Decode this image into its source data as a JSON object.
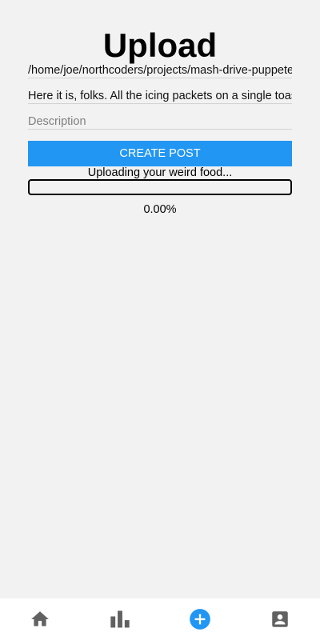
{
  "page": {
    "title": "Upload"
  },
  "form": {
    "file_path": "/home/joe/northcoders/projects/mash-drive-puppeteer",
    "caption": "Here it is, folks. All the icing packets on a single toaster",
    "description_placeholder": "Description",
    "create_label": "CREATE POST"
  },
  "upload": {
    "status_text": "Uploading your weird food...",
    "progress_fraction": 0.0,
    "percent_text": "0.00%"
  },
  "tabbar": {
    "tabs": [
      {
        "name": "home",
        "icon": "home-icon",
        "active": false
      },
      {
        "name": "leaderboard",
        "icon": "bar-chart-icon",
        "active": false
      },
      {
        "name": "upload",
        "icon": "add-circle-icon",
        "active": true
      },
      {
        "name": "profile",
        "icon": "account-box-icon",
        "active": false
      }
    ],
    "inactive_color": "#616161",
    "active_color": "#2196f3"
  },
  "colors": {
    "background": "#f2f2f2",
    "accent": "#2196f3"
  }
}
